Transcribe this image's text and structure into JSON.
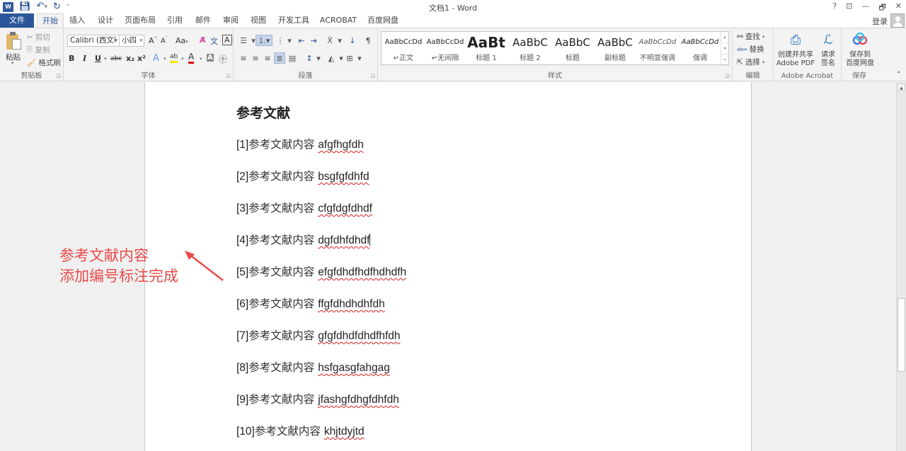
{
  "window": {
    "title": "文档1 - Word",
    "controls": [
      "?",
      "⊡",
      "—",
      "🗗",
      "✕"
    ],
    "login_label": "登录"
  },
  "quick_access": {
    "app_icon": "W",
    "save_icon": "save-icon",
    "undo_icon": "undo-icon",
    "redo_icon": "redo-icon",
    "customize_icon": "customize-icon"
  },
  "tabs": [
    {
      "label": "文件"
    },
    {
      "label": "开始",
      "active": true
    },
    {
      "label": "插入"
    },
    {
      "label": "设计"
    },
    {
      "label": "页面布局"
    },
    {
      "label": "引用"
    },
    {
      "label": "邮件"
    },
    {
      "label": "审阅"
    },
    {
      "label": "视图"
    },
    {
      "label": "开发工具"
    },
    {
      "label": "ACROBAT"
    },
    {
      "label": "百度网盘"
    }
  ],
  "ribbon": {
    "clipboard": {
      "label": "剪贴板",
      "paste": "粘贴",
      "cut": "剪切",
      "copy": "复制",
      "format_painter": "格式刷"
    },
    "font": {
      "label": "字体",
      "font_name": "Calibri (西文ī",
      "font_size": "小四",
      "grow": "A",
      "shrink": "A",
      "change_case": "Aa",
      "bold": "B",
      "italic": "I",
      "underline": "U",
      "strikethrough": "abc",
      "subscript": "x₂",
      "superscript": "x²",
      "text_effects": "A",
      "highlight": "ab",
      "font_color": "A",
      "shading": "A",
      "enclose": "㊉",
      "phonetic": "文",
      "border_char": "A",
      "highlight_color": "#f5e400",
      "font_color_value": "#e00000"
    },
    "paragraph": {
      "label": "段落"
    },
    "styles": {
      "label": "样式",
      "items": [
        {
          "sample": "AaBbCcDd",
          "name": "↵正文"
        },
        {
          "sample": "AaBbCcDd",
          "name": "↵无间隔"
        },
        {
          "sample": "AaBt",
          "name": "标题 1"
        },
        {
          "sample": "AaBbC",
          "name": "标题 2"
        },
        {
          "sample": "AaBbC",
          "name": "标题"
        },
        {
          "sample": "AaBbC",
          "name": "副标题"
        },
        {
          "sample": "AaBbCcDd",
          "name": "不明显强调"
        },
        {
          "sample": "AaBbCcDd",
          "name": "强调"
        }
      ]
    },
    "editing": {
      "label": "编辑",
      "find": "查找",
      "replace": "替换",
      "select": "选择"
    },
    "acrobat": {
      "label": "Adobe Acrobat",
      "create_share_line1": "创建并共享",
      "create_share_line2": "Adobe PDF",
      "request_sign_line1": "请求",
      "request_sign_line2": "签名"
    },
    "save": {
      "label": "保存",
      "save_baidu_line1": "保存到",
      "save_baidu_line2": "百度网盘"
    }
  },
  "document": {
    "heading": "参考文献",
    "references": [
      {
        "num": "[1]",
        "text": "参考文献内容",
        "latin": "afgfhgfdh"
      },
      {
        "num": "[2]",
        "text": "参考文献内容",
        "latin": "bsgfgfdhfd"
      },
      {
        "num": "[3]",
        "text": "参考文献内容",
        "latin": "cfgfdgfdhdf"
      },
      {
        "num": "[4]",
        "text": "参考文献内容",
        "latin": "dgfdhfdhdf"
      },
      {
        "num": "[5]",
        "text": "参考文献内容",
        "latin": "efgfdhdfhdfhdhdfh"
      },
      {
        "num": "[6]",
        "text": "参考文献内容",
        "latin": "ffgfdhdhdhfdh"
      },
      {
        "num": "[7]",
        "text": "参考文献内容",
        "latin": "gfgfdhdfdhdfhfdh"
      },
      {
        "num": "[8]",
        "text": "参考文献内容",
        "latin": "hsfgasgfahgag"
      },
      {
        "num": "[9]",
        "text": "参考文献内容",
        "latin": "jfashgfdhgfdhfdh"
      },
      {
        "num": "[10]",
        "text": "参考文献内容",
        "latin": "khjtdyjtd"
      }
    ],
    "annotation": {
      "line1": "参考文献内容",
      "line2": "添加编号标注完成",
      "color": "#e84a4a"
    }
  },
  "scrollbar": {
    "position_fraction": 0.72
  },
  "colors": {
    "accent": "#2b579a",
    "spellcheck": "#e02020"
  }
}
